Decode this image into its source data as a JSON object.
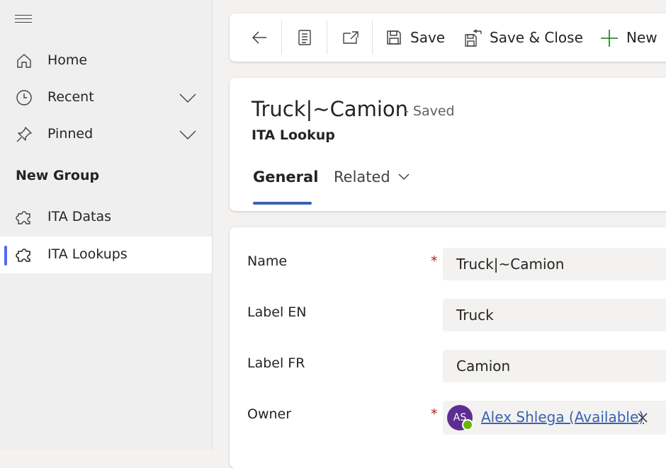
{
  "sidebar": {
    "items": [
      {
        "label": "Home",
        "icon": "home-icon"
      },
      {
        "label": "Recent",
        "icon": "clock-icon"
      },
      {
        "label": "Pinned",
        "icon": "pin-icon"
      }
    ],
    "group_title": "New Group",
    "group_items": [
      {
        "label": "ITA Datas",
        "icon": "puzzle-icon"
      },
      {
        "label": "ITA Lookups",
        "icon": "puzzle-icon",
        "selected": true
      }
    ]
  },
  "command_bar": {
    "save_label": "Save",
    "save_close_label": "Save & Close",
    "new_label": "New"
  },
  "record": {
    "title": "Truck|~Camion",
    "status": "- Saved",
    "entity": "ITA Lookup"
  },
  "tabs": [
    {
      "label": "General",
      "active": true
    },
    {
      "label": "Related",
      "active": false
    }
  ],
  "form": {
    "name": {
      "label": "Name",
      "required_mark": "*",
      "value": "Truck|~Camion"
    },
    "label_en": {
      "label": "Label EN",
      "value": "Truck"
    },
    "label_fr": {
      "label": "Label FR",
      "value": "Camion"
    },
    "owner": {
      "label": "Owner",
      "required_mark": "*",
      "initials": "AS",
      "value": "Alex Shlega (Available)"
    }
  },
  "colors": {
    "accent": "#3a62b0",
    "selection_bar": "#4f6bed",
    "required": "#a4262c",
    "avatar": "#5c2e91",
    "presence_available": "#6bb700",
    "new_plus": "#107c10"
  }
}
